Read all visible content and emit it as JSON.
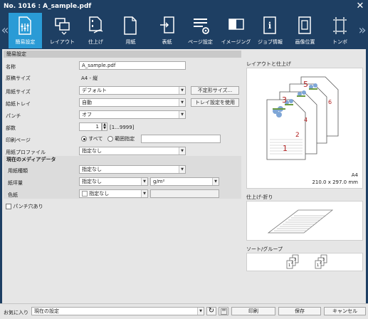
{
  "window": {
    "title": "No. 1016 : A_sample.pdf"
  },
  "tabs": [
    {
      "label": "簡易設定",
      "icon": "quick-settings-icon",
      "active": true
    },
    {
      "label": "レイアウト",
      "icon": "layout-icon"
    },
    {
      "label": "仕上げ",
      "icon": "finishing-icon"
    },
    {
      "label": "用紙",
      "icon": "paper-icon"
    },
    {
      "label": "表紙",
      "icon": "cover-icon"
    },
    {
      "label": "ページ設定",
      "icon": "page-settings-icon"
    },
    {
      "label": "イメージング",
      "icon": "imaging-icon"
    },
    {
      "label": "ジョブ情報",
      "icon": "job-info-icon"
    },
    {
      "label": "画像位置",
      "icon": "image-position-icon"
    },
    {
      "label": "トンボ",
      "icon": "crop-marks-icon"
    }
  ],
  "section": {
    "title": "簡易設定"
  },
  "form": {
    "name_label": "名称",
    "name_value": "A_sample.pdf",
    "orig_size_label": "原稿サイズ",
    "orig_size_value": "A4 - 縦",
    "paper_size_label": "用紙サイズ",
    "paper_size_value": "デフォルト",
    "custom_size_btn": "不定形サイズ...",
    "tray_label": "給紙トレイ",
    "tray_value": "自動",
    "use_tray_btn": "トレイ設定を使用",
    "punch_label": "パンチ",
    "punch_value": "オフ",
    "copies_label": "部数",
    "copies_value": "1",
    "copies_range": "[1...9999]",
    "print_pages_label": "印刷ページ",
    "all_label": "すべて",
    "range_label": "範囲指定",
    "range_value": "",
    "paper_profile_label": "用紙プロファイル",
    "paper_profile_value": "指定なし"
  },
  "media": {
    "title": "現在のメディアデータ",
    "paper_type_label": "用紙種類",
    "paper_type_value": "指定なし",
    "weight_label": "紙坪量",
    "weight_value": "指定なし",
    "weight_unit": "g/m²",
    "weight_extra": "",
    "color_label": "色紙",
    "color_value": "指定なし",
    "color_extra": "",
    "punched_label": "パンチ穴あり"
  },
  "preview": {
    "layout_title": "レイアウトと仕上げ",
    "size_name": "A4",
    "size_dims": "210.0 x 297.0 mm",
    "page_numbers": [
      "1",
      "2",
      "3",
      "4",
      "5",
      "6"
    ],
    "fold_title": "仕上げ-折り",
    "sort_title": "ソート/グループ",
    "sort_numbers": [
      "1",
      "2",
      "3",
      "1",
      "2",
      "3"
    ]
  },
  "bottom": {
    "favorites_label": "お気に入り",
    "favorites_value": "現在の設定",
    "print_btn": "印刷",
    "save_btn": "保存",
    "cancel_btn": "キャンセル"
  },
  "colors": {
    "titlebar": "#1e3f63",
    "active_tab": "#2a9bd6",
    "page_number": "#b22222"
  }
}
